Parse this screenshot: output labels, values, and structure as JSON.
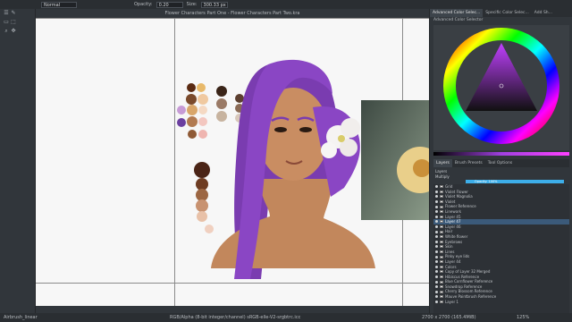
{
  "toolbar": {
    "blend_mode": "Normal",
    "opacity_label": "Opacity:",
    "opacity_value": "0.20",
    "size_label": "Size:",
    "size_value": "300.33 px"
  },
  "document": {
    "title": "Flower Characters Part One - Flower Characters Part Two.kra"
  },
  "right_panel": {
    "tabs": [
      "Advanced Color Selec...",
      "Specific Color Selec...",
      "Add Sh..."
    ],
    "selector_title": "Advanced Color Selector",
    "layers_tabs": [
      "Layers",
      "Brush Presets",
      "Tool Options"
    ],
    "layers_header": "Layers",
    "blend": "Multiply",
    "opacity_text": "Opacity:  100%",
    "layers": [
      "Grid",
      "Violet Flower",
      "Violet Magnolia",
      "Violet",
      "Flower Reference",
      "Linework",
      "Layer 45",
      "Layer 47",
      "Layer 46",
      "Hair",
      "White flower",
      "Eyebrows",
      "Skin",
      "Lines",
      "Pinky eye lids",
      "Layer 44",
      "Colors",
      "Copy of Layer 32 Merged",
      "Hibiscus Reference",
      "Blue Cornflower Reference",
      "Snowdrop Reference",
      "Cherry Blossom Reference",
      "Mauve Paintbrush Reference",
      "Layer 1"
    ],
    "selected_layer_index": 7
  },
  "status": {
    "brush": "Airbrush_linear",
    "color_space": "RGB/Alpha (8-bit integer/channel)  sRGB-elle-V2-srgbtrc.icc",
    "dimensions": "2700 x 2700 (165.4MiB)",
    "zoom": "125%"
  },
  "colors": {
    "accent": "#3daee9",
    "hair": "#7a3cb0",
    "skin": "#c2875c"
  },
  "icons": [
    "menu-icon",
    "brush-icon",
    "eraser-icon",
    "selection-icon",
    "zoom-icon",
    "eye-icon"
  ]
}
